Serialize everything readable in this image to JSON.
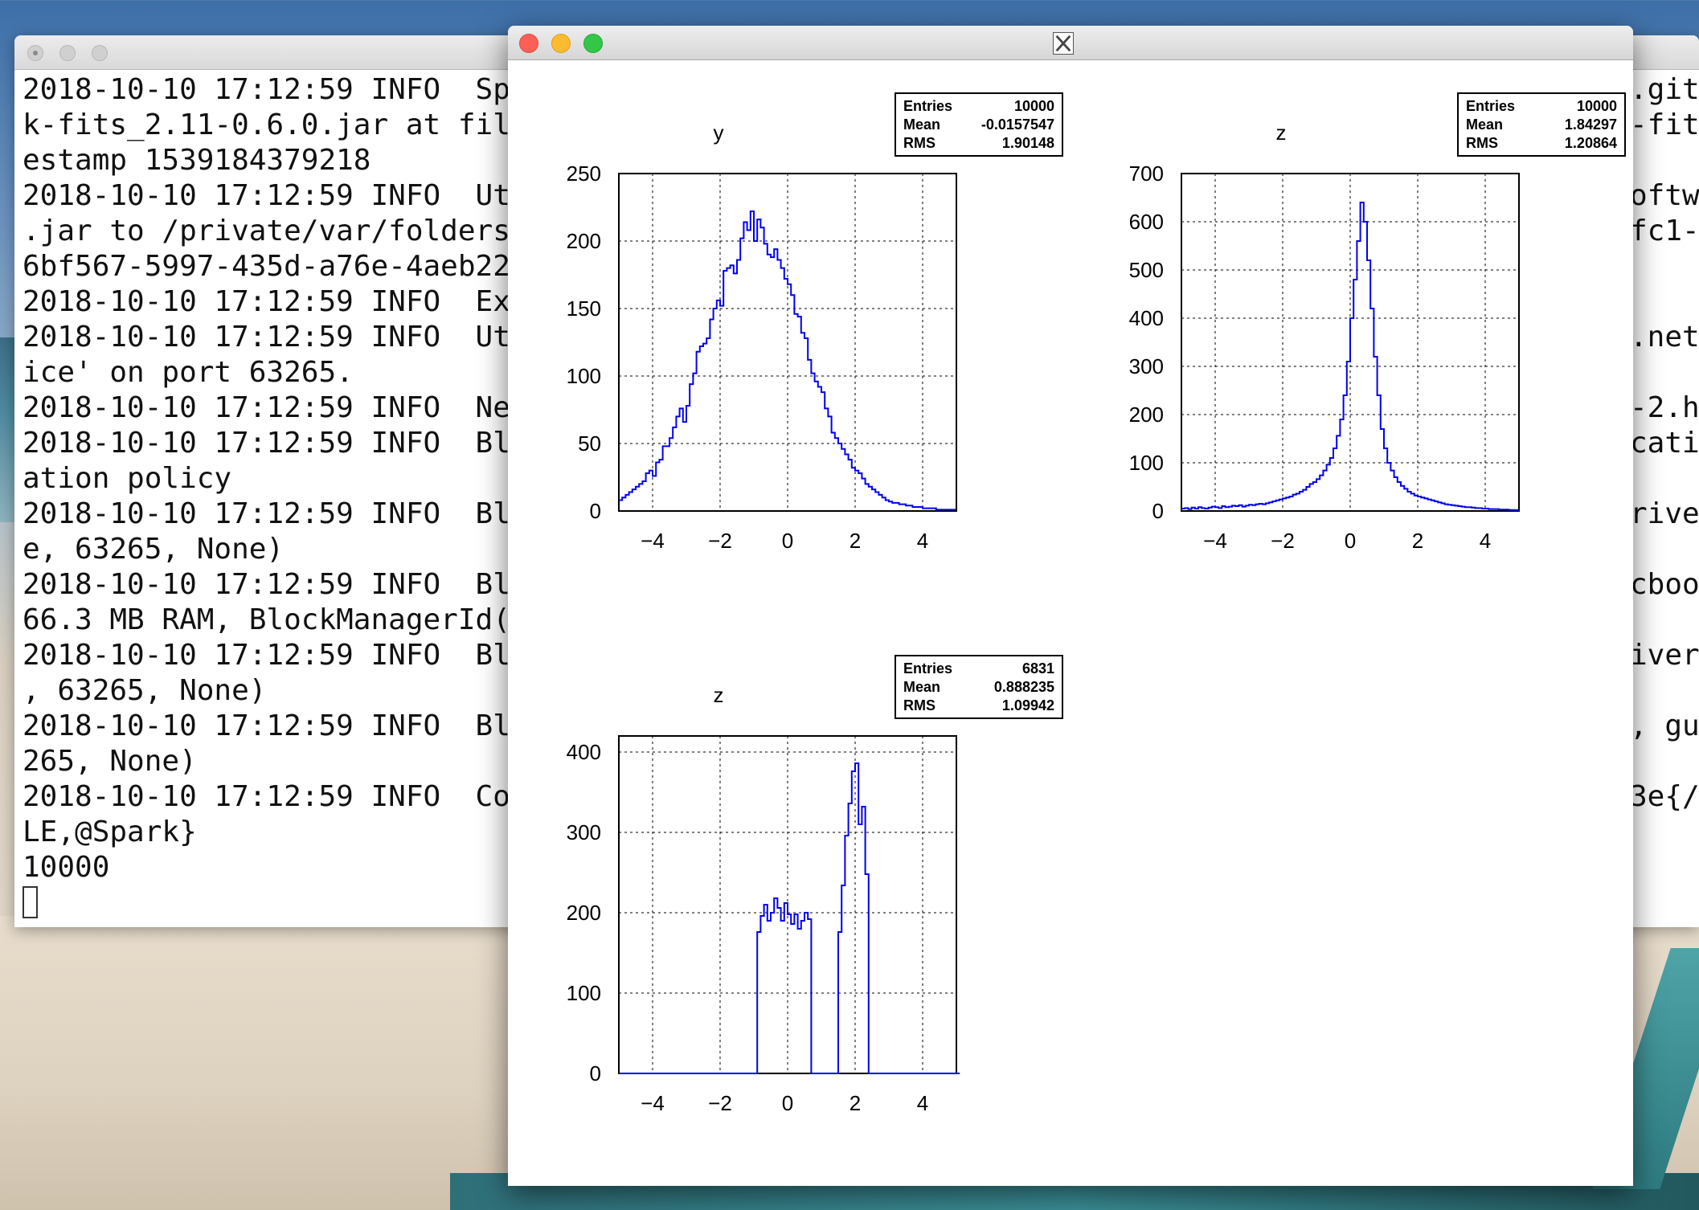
{
  "terminal": {
    "lines": [
      "2018-10-10 17:12:59 INFO  Sp",
      "k-fits_2.11-0.6.0.jar at fil",
      "estamp 1539184379218",
      "2018-10-10 17:12:59 INFO  Ut",
      ".jar to /private/var/folders",
      "6bf567-5997-435d-a76e-4aeb22",
      "2018-10-10 17:12:59 INFO  Ex",
      "2018-10-10 17:12:59 INFO  Ut",
      "ice' on port 63265.",
      "2018-10-10 17:12:59 INFO  Ne",
      "2018-10-10 17:12:59 INFO  Bl",
      "ation policy",
      "2018-10-10 17:12:59 INFO  Bl",
      "e, 63265, None)",
      "2018-10-10 17:12:59 INFO  Bl",
      "66.3 MB RAM, BlockManagerId(",
      "2018-10-10 17:12:59 INFO  Bl",
      ", 63265, None)",
      "2018-10-10 17:12:59 INFO  Bl",
      "265, None)",
      "2018-10-10 17:12:59 INFO  Co",
      "LE,@Spark}",
      "10000"
    ],
    "right_lines": [
      ".git",
      "-fit",
      "",
      "oftw",
      "fc1-",
      "",
      "",
      ".net",
      "",
      "-2.h",
      "cati",
      "",
      "rive",
      "",
      "cboo",
      "",
      "iver",
      "",
      ", gu",
      "",
      "3e{/",
      "",
      ""
    ]
  },
  "root_window": {
    "title_icon": "x11-icon"
  },
  "chart_data": [
    {
      "type": "histogram",
      "title": "y",
      "stats": {
        "Entries": "10000",
        "Mean": "-0.0157547",
        "RMS": "1.90148"
      },
      "xlim": [
        -5,
        5
      ],
      "ylim": [
        0,
        250
      ],
      "xticks": [
        "−4",
        "−2",
        "0",
        "2",
        "4"
      ],
      "yticks": [
        "0",
        "50",
        "100",
        "150",
        "200",
        "250"
      ],
      "bin_start": -5,
      "bin_width": 0.1,
      "values": [
        8,
        10,
        12,
        14,
        16,
        18,
        20,
        22,
        28,
        30,
        26,
        36,
        38,
        48,
        48,
        54,
        62,
        70,
        76,
        66,
        78,
        94,
        102,
        118,
        122,
        124,
        128,
        142,
        150,
        156,
        152,
        178,
        180,
        182,
        176,
        186,
        202,
        214,
        208,
        222,
        200,
        216,
        210,
        198,
        190,
        188,
        194,
        186,
        180,
        172,
        168,
        160,
        146,
        144,
        132,
        128,
        112,
        102,
        96,
        92,
        88,
        76,
        70,
        58,
        54,
        50,
        46,
        42,
        38,
        32,
        30,
        28,
        24,
        20,
        18,
        16,
        14,
        12,
        10,
        8,
        7,
        6,
        6,
        5,
        5,
        4,
        4,
        3,
        3,
        3,
        2,
        2,
        2,
        2,
        1,
        1,
        1,
        1,
        1,
        1
      ]
    },
    {
      "type": "histogram",
      "title": "z",
      "stats": {
        "Entries": "10000",
        "Mean": "1.84297",
        "RMS": "1.20864"
      },
      "xlim": [
        -5,
        5
      ],
      "ylim": [
        0,
        700
      ],
      "xticks": [
        "−4",
        "−2",
        "0",
        "2",
        "4"
      ],
      "yticks": [
        "0",
        "100",
        "200",
        "300",
        "400",
        "500",
        "600",
        "700"
      ],
      "bin_start": -5,
      "bin_width": 0.1,
      "values": [
        5,
        6,
        4,
        7,
        5,
        8,
        6,
        5,
        7,
        9,
        8,
        6,
        10,
        8,
        9,
        11,
        10,
        12,
        9,
        11,
        13,
        12,
        14,
        15,
        14,
        16,
        18,
        20,
        22,
        24,
        26,
        28,
        30,
        34,
        36,
        40,
        44,
        50,
        56,
        60,
        66,
        74,
        84,
        96,
        110,
        130,
        156,
        190,
        240,
        310,
        400,
        480,
        560,
        640,
        600,
        520,
        420,
        320,
        240,
        170,
        130,
        100,
        84,
        70,
        60,
        52,
        46,
        40,
        36,
        32,
        30,
        28,
        26,
        24,
        22,
        20,
        18,
        16,
        14,
        13,
        12,
        11,
        10,
        9,
        8,
        8,
        7,
        6,
        6,
        5,
        5,
        4,
        4,
        4,
        3,
        3,
        3,
        2,
        2,
        2
      ]
    },
    {
      "type": "histogram",
      "title": "z",
      "stats": {
        "Entries": "6831",
        "Mean": "0.888235",
        "RMS": "1.09942"
      },
      "xlim": [
        -5,
        5
      ],
      "ylim": [
        0,
        420
      ],
      "xticks": [
        "−4",
        "−2",
        "0",
        "2",
        "4"
      ],
      "yticks": [
        "0",
        "100",
        "200",
        "300",
        "400"
      ],
      "bin_start": -5,
      "bin_width": 0.1,
      "values": [
        0,
        0,
        0,
        0,
        0,
        0,
        0,
        0,
        0,
        0,
        0,
        0,
        0,
        0,
        0,
        0,
        0,
        0,
        0,
        0,
        0,
        0,
        0,
        0,
        0,
        0,
        0,
        0,
        0,
        0,
        0,
        0,
        0,
        0,
        0,
        0,
        0,
        0,
        0,
        0,
        0,
        176,
        196,
        210,
        190,
        200,
        218,
        206,
        190,
        212,
        198,
        186,
        198,
        180,
        190,
        200,
        192,
        0,
        0,
        0,
        0,
        0,
        0,
        0,
        0,
        176,
        234,
        296,
        336,
        376,
        386,
        310,
        332,
        248,
        0,
        0,
        0,
        0,
        0,
        0,
        0,
        0,
        0,
        0,
        0,
        0,
        0,
        0,
        0,
        0,
        0,
        0,
        0,
        0,
        0,
        0,
        0,
        0,
        0,
        0,
        0
      ]
    }
  ]
}
